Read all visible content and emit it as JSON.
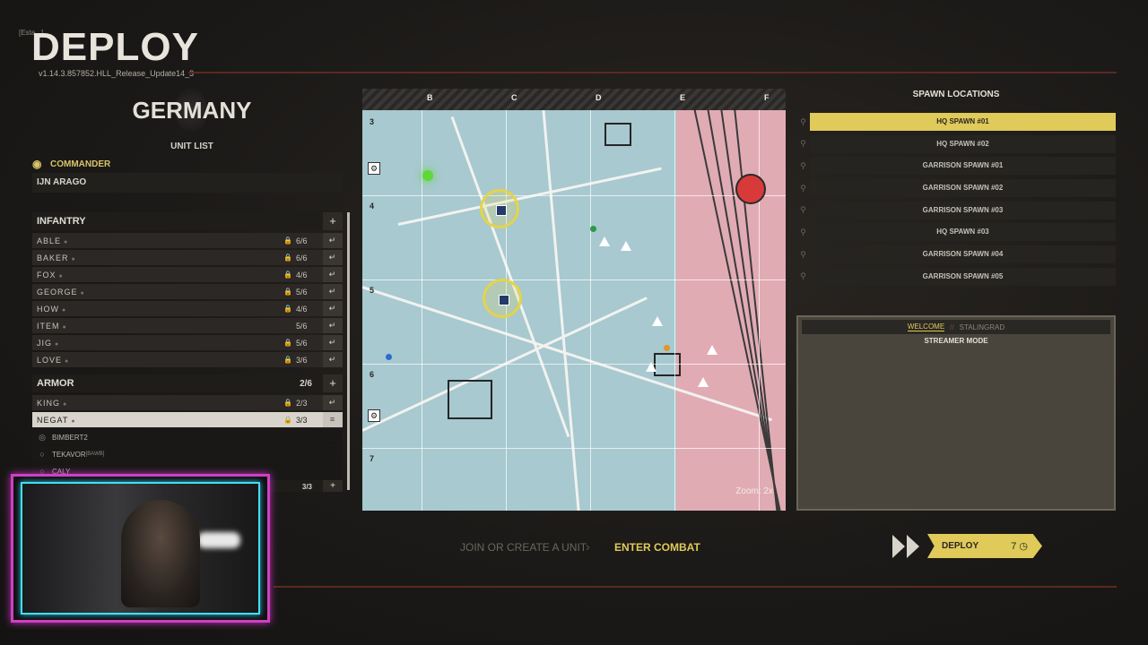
{
  "header": {
    "title": "DEPLOY",
    "title_small": "[Esta...]",
    "version": "v1.14.3.857852.HLL_Release_Update14_3"
  },
  "faction": {
    "name": "GERMANY",
    "unit_list_label": "UNIT LIST"
  },
  "commander": {
    "label": "COMMANDER",
    "name": "IJN ARAGO"
  },
  "infantry": {
    "label": "INFANTRY",
    "add": "+",
    "squads": [
      {
        "name": "ABLE",
        "count": "6/6"
      },
      {
        "name": "BAKER",
        "count": "6/6"
      },
      {
        "name": "FOX",
        "count": "4/6"
      },
      {
        "name": "GEORGE",
        "count": "5/6"
      },
      {
        "name": "HOW",
        "count": "4/6"
      },
      {
        "name": "ITEM",
        "count": "5/6"
      },
      {
        "name": "JIG",
        "count": "5/6"
      },
      {
        "name": "LOVE",
        "count": "3/6"
      }
    ]
  },
  "armor": {
    "label": "ARMOR",
    "count": "2/6",
    "add": "+",
    "squads": [
      {
        "name": "KING",
        "count": "2/3"
      },
      {
        "name": "NEGAT",
        "count": "3/3"
      }
    ],
    "members": [
      "BIMBERT2",
      "TEKAVOR",
      "CALY"
    ],
    "member_tag": "[BAWB]",
    "cut_off_count": "3/3"
  },
  "map": {
    "columns": [
      "B",
      "C",
      "D",
      "E",
      "F"
    ],
    "rows": [
      "3",
      "4",
      "5",
      "6",
      "7"
    ],
    "zoom": "Zoom: 2x"
  },
  "spawn_locations": {
    "title": "SPAWN LOCATIONS",
    "items": [
      "HQ SPAWN #01",
      "HQ SPAWN #02",
      "GARRISON SPAWN #01",
      "GARRISON SPAWN #02",
      "GARRISON SPAWN #03",
      "HQ SPAWN #03",
      "GARRISON SPAWN #04",
      "GARRISON SPAWN #05"
    ]
  },
  "chat": {
    "tab_active": "WELCOME",
    "tab_sep": "//",
    "tab_inactive": "STALINGRAD",
    "message": "STREAMER MODE"
  },
  "steps": {
    "join": "JOIN OR CREATE A UNIT",
    "enter": "ENTER COMBAT"
  },
  "deploy": {
    "label": "DEPLOY",
    "timer": "7"
  },
  "colors": {
    "accent": "#e0ca5a",
    "map_allied": "#a7c9cf",
    "map_enemy": "#e8a7b0",
    "webcam_border": "#d040c0"
  }
}
